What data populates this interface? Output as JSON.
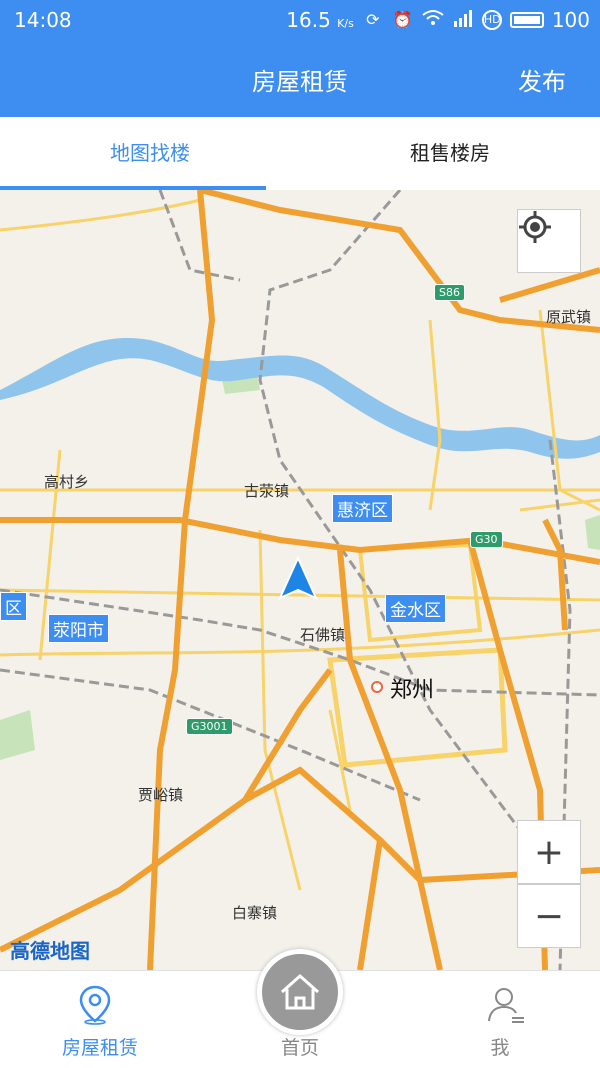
{
  "status_bar": {
    "time": "14:08",
    "speed": "16.5",
    "speed_unit": "K/s",
    "battery": "100",
    "icons": [
      "data-speed-icon",
      "alarm-icon",
      "wifi-icon",
      "4g-signal-icon",
      "hd-icon",
      "battery-icon"
    ]
  },
  "appbar": {
    "title": "房屋租赁",
    "action": "发布"
  },
  "tabs": [
    {
      "label": "地图找楼",
      "active": true
    },
    {
      "label": "租售楼房",
      "active": false
    }
  ],
  "map": {
    "places": {
      "gaocun": "高村乡",
      "guxing": "古荥镇",
      "shifo": "石佛镇",
      "zhengzhou": "郑州",
      "jiayu": "贾峪镇",
      "baizhai": "白寨镇",
      "yuanwu": "原武镇"
    },
    "districts": {
      "huiji": "惠济区",
      "jinshui": "金水区",
      "xingyang": "荥阳市",
      "edge": "区"
    },
    "roads": {
      "s86": "S86",
      "g30": "G30",
      "g3001": "G3001"
    },
    "logo": "高德地图",
    "buttons": {
      "locate": "locate-icon",
      "zoom_in": "+",
      "zoom_out": "−"
    }
  },
  "bottom_nav": [
    {
      "label": "房屋租赁",
      "icon": "location-pin-icon",
      "active": true
    },
    {
      "label": "首页",
      "icon": "home-icon",
      "active": false
    },
    {
      "label": "我",
      "icon": "user-icon",
      "active": false
    }
  ],
  "colors": {
    "primary": "#3d8ef0",
    "map_bg": "#f3f1ea",
    "river": "#8fc4ec",
    "highway": "#f0a030",
    "road": "#f7d36a"
  }
}
